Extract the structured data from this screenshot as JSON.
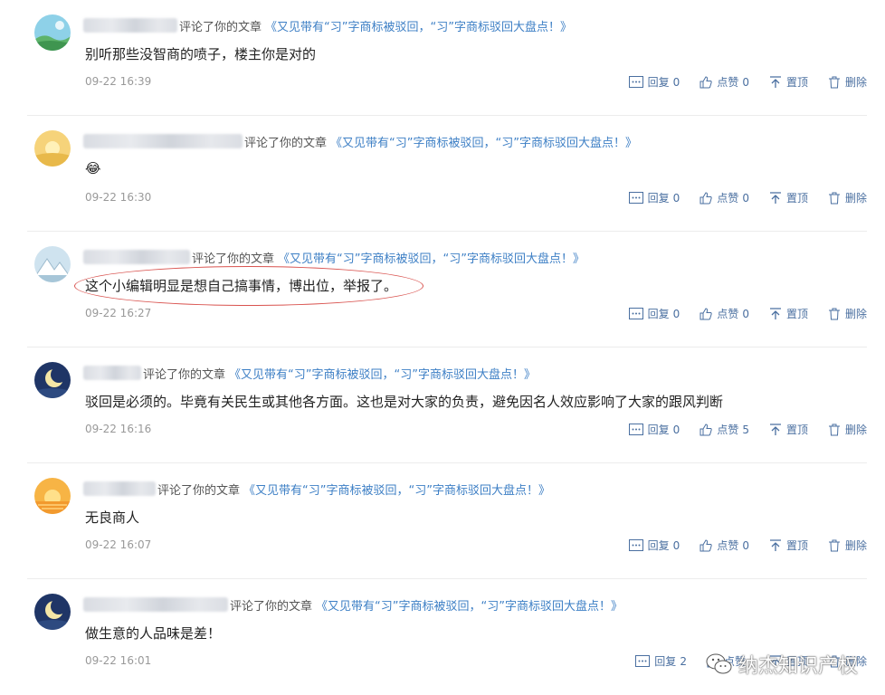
{
  "comments": [
    {
      "avatar": "meadow-avatar",
      "commented_text": "评论了你的文章",
      "article": "《又见带有“习”字商标被驳回，“习”字商标驳回大盘点！》",
      "content": "别听那些没智商的喷子，楼主你是对的",
      "time": "09-22 16:39",
      "reply_label": "回复",
      "reply_count": "0",
      "like_label": "点赞",
      "like_count": "0",
      "pin_label": "置顶",
      "delete_label": "删除"
    },
    {
      "avatar": "sunset-avatar",
      "commented_text": "评论了你的文章",
      "article": "《又见带有“习”字商标被驳回，“习”字商标驳回大盘点！》",
      "content": "😂",
      "time": "09-22 16:30",
      "reply_label": "回复",
      "reply_count": "0",
      "like_label": "点赞",
      "like_count": "0",
      "pin_label": "置顶",
      "delete_label": "删除"
    },
    {
      "avatar": "mountain-avatar",
      "commented_text": "评论了你的文章",
      "article": "《又见带有“习”字商标被驳回，“习”字商标驳回大盘点！》",
      "content": "这个小编辑明显是想自己搞事情，博出位，举报了。",
      "time": "09-22 16:27",
      "reply_label": "回复",
      "reply_count": "0",
      "like_label": "点赞",
      "like_count": "0",
      "pin_label": "置顶",
      "delete_label": "删除"
    },
    {
      "avatar": "moon-avatar",
      "commented_text": "评论了你的文章",
      "article": "《又见带有“习”字商标被驳回，“习”字商标驳回大盘点！》",
      "content": "驳回是必须的。毕竟有关民生或其他各方面。这也是对大家的负责，避免因名人效应影响了大家的跟风判断",
      "time": "09-22 16:16",
      "reply_label": "回复",
      "reply_count": "0",
      "like_label": "点赞",
      "like_count": "5",
      "pin_label": "置顶",
      "delete_label": "删除"
    },
    {
      "avatar": "sunset-avatar",
      "commented_text": "评论了你的文章",
      "article": "《又见带有“习”字商标被驳回，“习”字商标驳回大盘点！》",
      "content": "无良商人",
      "time": "09-22 16:07",
      "reply_label": "回复",
      "reply_count": "0",
      "like_label": "点赞",
      "like_count": "0",
      "pin_label": "置顶",
      "delete_label": "删除"
    },
    {
      "avatar": "moon-avatar",
      "commented_text": "评论了你的文章",
      "article": "《又见带有“习”字商标被驳回，“习”字商标驳回大盘点！》",
      "content": "做生意的人品味是差！",
      "time": "09-22 16:01",
      "reply_label": "回复",
      "reply_count": "2",
      "like_label": "点赞",
      "like_count": "",
      "pin_label": "置顶",
      "delete_label": "删除"
    }
  ],
  "watermark": "纳杰知识产权",
  "colors": {
    "link": "#3d7fc5",
    "action": "#4a6fa0",
    "time": "#999999",
    "highlight_ring": "#d9534f"
  }
}
